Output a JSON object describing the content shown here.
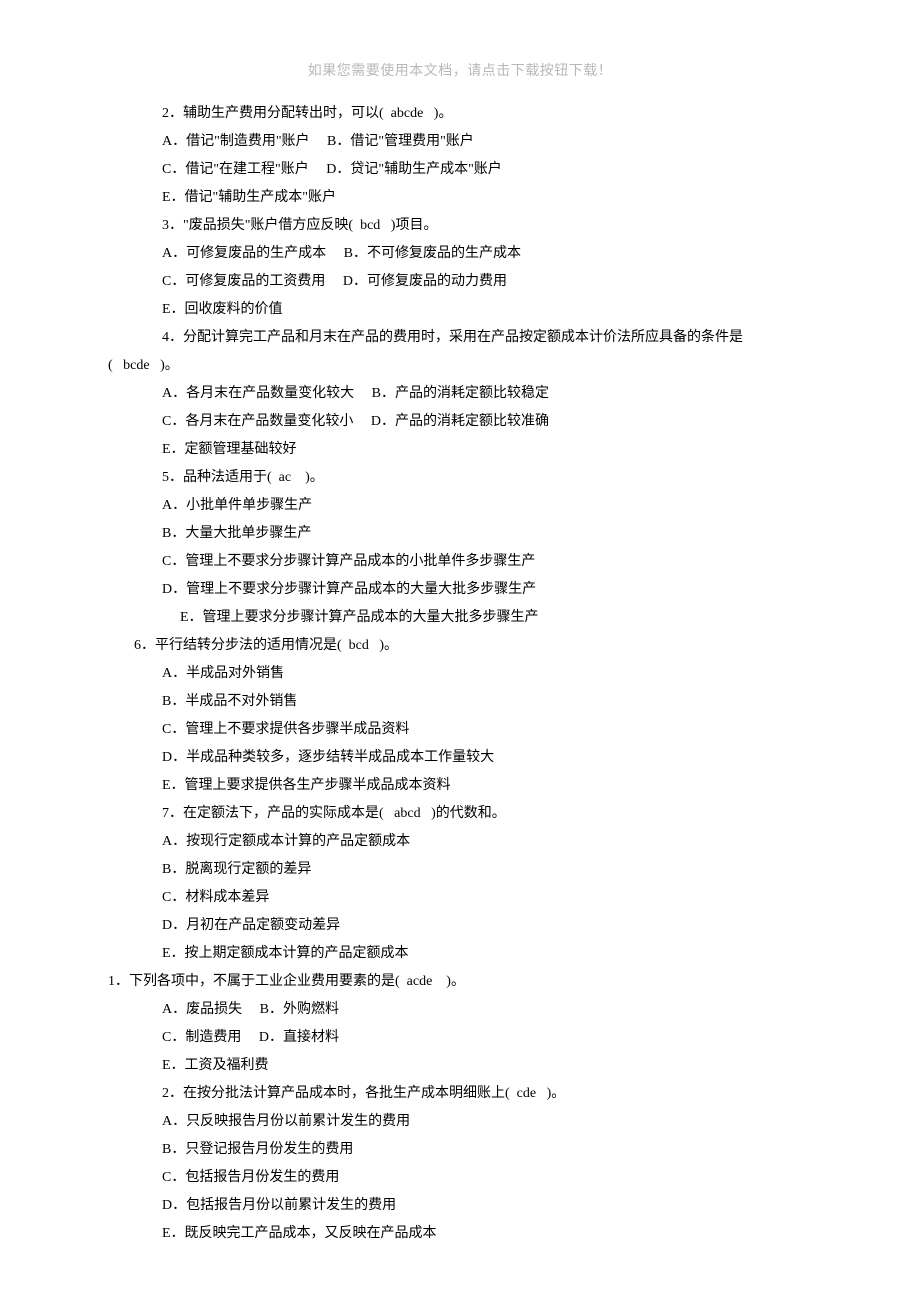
{
  "header_note": "如果您需要使用本文档，请点击下载按钮下载！",
  "lines": [
    {
      "cls": "i1",
      "t": "2．辅助生产费用分配转出时，可以(  abcde   )。"
    },
    {
      "cls": "i1",
      "t": "A．借记\"制造费用\"账户     B．借记\"管理费用\"账户"
    },
    {
      "cls": "i1",
      "t": "C．借记\"在建工程\"账户     D．贷记\"辅助生产成本\"账户"
    },
    {
      "cls": "i1",
      "t": "E．借记\"辅助生产成本\"账户"
    },
    {
      "cls": "i1",
      "t": "3．\"废品损失\"账户借方应反映(  bcd   )项目。"
    },
    {
      "cls": "i1",
      "t": "A．可修复废品的生产成本     B．不可修复废品的生产成本"
    },
    {
      "cls": "i1",
      "t": "C．可修复废品的工资费用     D．可修复废品的动力费用"
    },
    {
      "cls": "i1",
      "t": "E．回收废料的价值"
    },
    {
      "cls": "i1",
      "t": "4．分配计算完工产品和月末在产品的费用时，采用在产品按定额成本计价法所应具备的条件是"
    },
    {
      "cls": "i0",
      "t": "(   bcde   )。"
    },
    {
      "cls": "i1",
      "t": "A．各月末在产品数量变化较大     B．产品的消耗定额比较稳定"
    },
    {
      "cls": "i1",
      "t": "C．各月末在产品数量变化较小     D．产品的消耗定额比较准确"
    },
    {
      "cls": "i1",
      "t": "E．定额管理基础较好"
    },
    {
      "cls": "i1",
      "t": "5．品种法适用于(  ac    )。"
    },
    {
      "cls": "i1",
      "t": "A．小批单件单步骤生产"
    },
    {
      "cls": "i1",
      "t": "B．大量大批单步骤生产"
    },
    {
      "cls": "i1",
      "t": "C．管理上不要求分步骤计算产品成本的小批单件多步骤生产"
    },
    {
      "cls": "i1",
      "t": "D．管理上不要求分步骤计算产品成本的大量大批多步骤生产"
    },
    {
      "cls": "i2",
      "t": "E．管理上要求分步骤计算产品成本的大量大批多步骤生产"
    },
    {
      "cls": "iq",
      "t": "6．平行结转分步法的适用情况是(  bcd   )。"
    },
    {
      "cls": "i1",
      "t": "A．半成品对外销售"
    },
    {
      "cls": "i1",
      "t": "B．半成品不对外销售"
    },
    {
      "cls": "i1",
      "t": "C．管理上不要求提供各步骤半成品资料"
    },
    {
      "cls": "i1",
      "t": "D．半成品种类较多，逐步结转半成品成本工作量较大"
    },
    {
      "cls": "i1",
      "t": "E．管理上要求提供各生产步骤半成品成本资料"
    },
    {
      "cls": "i1",
      "t": "7．在定额法下，产品的实际成本是(   abcd   )的代数和。"
    },
    {
      "cls": "i1",
      "t": "A．按现行定额成本计算的产品定额成本"
    },
    {
      "cls": "i1",
      "t": "B．脱离现行定额的差异"
    },
    {
      "cls": "i1",
      "t": "C．材料成本差异"
    },
    {
      "cls": "i1",
      "t": "D．月初在产品定额变动差异"
    },
    {
      "cls": "i1",
      "t": "E．按上期定额成本计算的产品定额成本"
    },
    {
      "cls": "iq0",
      "t": "1．下列各项中，不属于工业企业费用要素的是(  acde    )。"
    },
    {
      "cls": "i1",
      "t": "A．废品损失     B．外购燃料"
    },
    {
      "cls": "i1",
      "t": "C．制造费用     D．直接材料"
    },
    {
      "cls": "i1",
      "t": "E．工资及福利费"
    },
    {
      "cls": "i1",
      "t": "2．在按分批法计算产品成本时，各批生产成本明细账上(  cde   )。"
    },
    {
      "cls": "i1",
      "t": "A．只反映报告月份以前累计发生的费用"
    },
    {
      "cls": "i1",
      "t": "B．只登记报告月份发生的费用"
    },
    {
      "cls": "i1",
      "t": "C．包括报告月份发生的费用"
    },
    {
      "cls": "i1",
      "t": "D．包括报告月份以前累计发生的费用"
    },
    {
      "cls": "i1",
      "t": "E．既反映完工产品成本，又反映在产品成本"
    }
  ]
}
